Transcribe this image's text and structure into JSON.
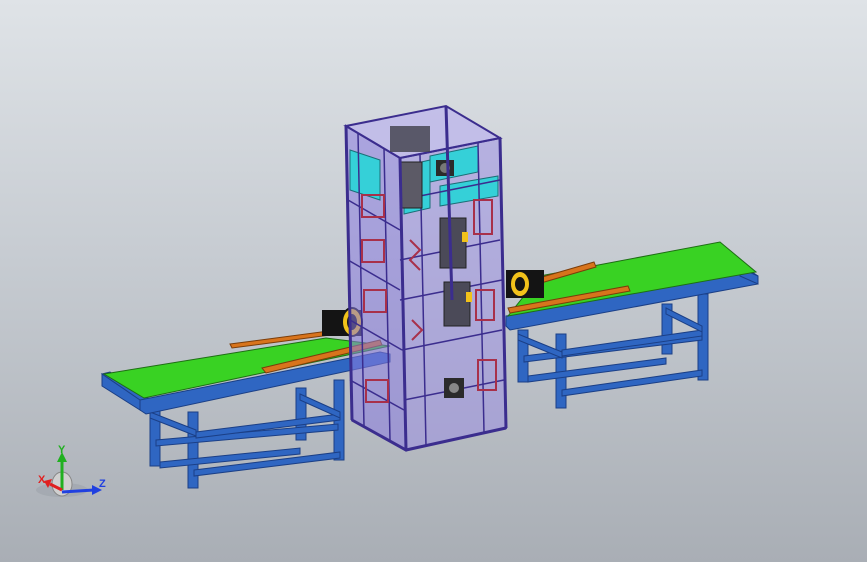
{
  "colors": {
    "background_top": "#dfe3e7",
    "background_bottom": "#a9aeb5",
    "frame_blue": "#2f66c2",
    "frame_blue_dark": "#1b3f86",
    "belt_green": "#39d223",
    "tower_purple": "#8a7be0",
    "tower_outline": "#3b2d8e",
    "panel_cyan": "#35d0d8",
    "guide_orange": "#d8741c",
    "motor_yellow": "#f2c21a",
    "motor_black": "#141414"
  },
  "axis_triad": {
    "x_label": "X",
    "y_label": "Y",
    "z_label": "Z",
    "x_color": "#e02020",
    "y_color": "#20b020",
    "z_color": "#2040e0"
  }
}
